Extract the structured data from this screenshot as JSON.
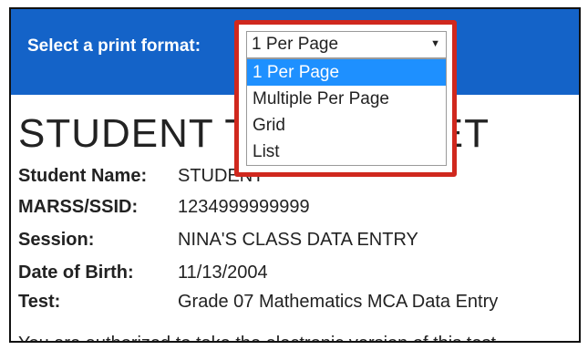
{
  "header": {
    "label": "Select a print format:"
  },
  "print_format": {
    "selected": "1 Per Page",
    "options": [
      "1 Per Page",
      "Multiple Per Page",
      "Grid",
      "List"
    ],
    "highlighted_index": 0
  },
  "ticket": {
    "title": "STUDENT TEST TICKET",
    "fields": [
      {
        "label": "Student Name:",
        "value": "STUDENT"
      },
      {
        "label": "MARSS/SSID:",
        "value": "1234999999999"
      },
      {
        "label": "Session:",
        "value": "NINA'S CLASS DATA ENTRY"
      },
      {
        "label": "Date of Birth:",
        "value": "11/13/2004"
      },
      {
        "label": "Test:",
        "value": "Grade 07 Mathematics MCA Data Entry"
      }
    ],
    "footer": "You are authorized to take the electronic version of this test"
  },
  "colors": {
    "header_bg": "#1463c8",
    "highlight": "#d0281e",
    "option_selected": "#1e90ff"
  }
}
